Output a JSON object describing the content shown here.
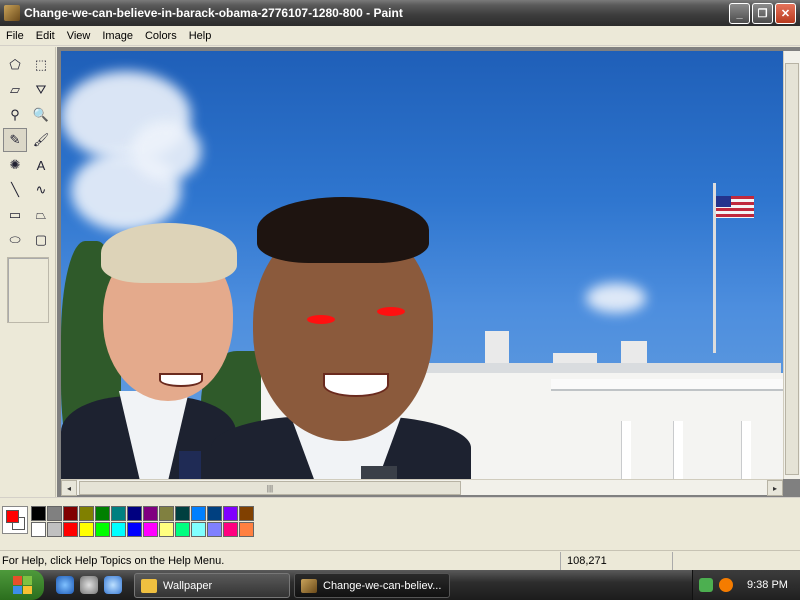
{
  "window": {
    "title": "Change-we-can-believe-in-barack-obama-2776107-1280-800 - Paint",
    "minimize": "_",
    "maximize": "❐",
    "close": "✕"
  },
  "menu": [
    "File",
    "Edit",
    "View",
    "Image",
    "Colors",
    "Help"
  ],
  "tools": [
    {
      "name": "free-select",
      "glyph": "⬠"
    },
    {
      "name": "rect-select",
      "glyph": "⬚"
    },
    {
      "name": "eraser",
      "glyph": "▱"
    },
    {
      "name": "fill",
      "glyph": "⛛"
    },
    {
      "name": "color-picker",
      "glyph": "⚲"
    },
    {
      "name": "magnifier",
      "glyph": "🔍"
    },
    {
      "name": "pencil",
      "glyph": "✎"
    },
    {
      "name": "brush",
      "glyph": "🖌"
    },
    {
      "name": "airbrush",
      "glyph": "✺"
    },
    {
      "name": "text",
      "glyph": "A"
    },
    {
      "name": "line",
      "glyph": "╲"
    },
    {
      "name": "curve",
      "glyph": "∿"
    },
    {
      "name": "rectangle",
      "glyph": "▭"
    },
    {
      "name": "polygon",
      "glyph": "⏢"
    },
    {
      "name": "ellipse",
      "glyph": "⬭"
    },
    {
      "name": "rounded-rect",
      "glyph": "▢"
    }
  ],
  "active_tool": "pencil",
  "colors": {
    "foreground": "#ff0000",
    "background": "#ffffff",
    "palette": [
      "#000000",
      "#808080",
      "#800000",
      "#808000",
      "#008000",
      "#008080",
      "#000080",
      "#800080",
      "#808040",
      "#004040",
      "#0080ff",
      "#004080",
      "#8000ff",
      "#804000",
      "#ffffff",
      "#c0c0c0",
      "#ff0000",
      "#ffff00",
      "#00ff00",
      "#00ffff",
      "#0000ff",
      "#ff00ff",
      "#ffff80",
      "#00ff80",
      "#80ffff",
      "#8080ff",
      "#ff0080",
      "#ff8040"
    ]
  },
  "scrollbar": {
    "left_arrow": "◂",
    "right_arrow": "▸",
    "grip": "|||"
  },
  "status": {
    "help": "For Help, click Help Topics on the Help Menu.",
    "coords": "108,271"
  },
  "taskbar": {
    "tasks": [
      {
        "label": "Wallpaper",
        "active": false
      },
      {
        "label": "Change-we-can-believ...",
        "active": true
      }
    ],
    "clock": "9:38 PM"
  }
}
